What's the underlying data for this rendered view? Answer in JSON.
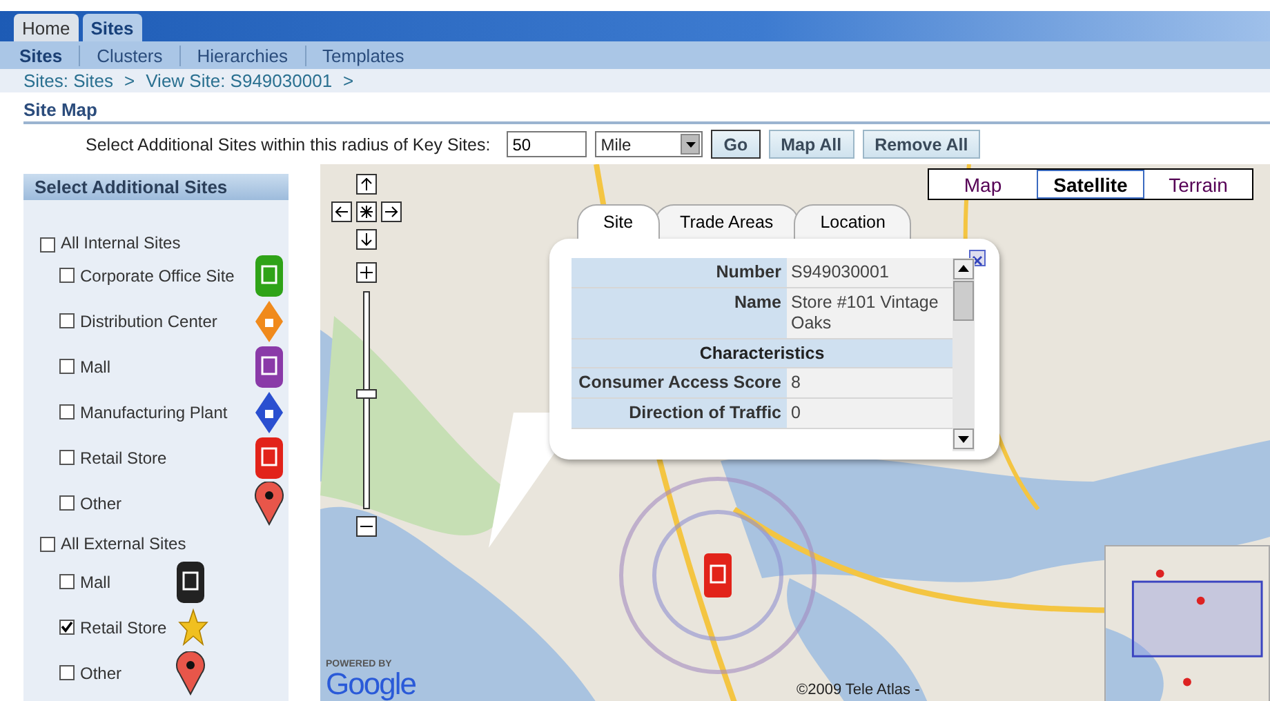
{
  "top_tabs": [
    {
      "label": "Home",
      "selected": false
    },
    {
      "label": "Sites",
      "selected": true
    }
  ],
  "sub_nav": [
    {
      "label": "Sites",
      "selected": true
    },
    {
      "label": "Clusters",
      "selected": false
    },
    {
      "label": "Hierarchies",
      "selected": false
    },
    {
      "label": "Templates",
      "selected": false
    }
  ],
  "breadcrumbs": {
    "separator": ">",
    "items": [
      "Sites: Sites",
      "View Site: S949030001"
    ]
  },
  "section_title": "Site Map",
  "radius": {
    "label": "Select Additional Sites within this radius of Key Sites:",
    "value": "50",
    "unit": "Mile",
    "buttons": [
      "Go",
      "Map All",
      "Remove All"
    ]
  },
  "filter_panel": {
    "title": "Select Additional Sites",
    "groups": [
      {
        "label": "All Internal Sites",
        "checked": false,
        "children": [
          {
            "label": "Corporate Office Site",
            "checked": false,
            "kind": "badge",
            "color": "#2fa318"
          },
          {
            "label": "Distribution Center",
            "checked": false,
            "kind": "diamond",
            "color": "#f08a1c"
          },
          {
            "label": "Mall",
            "checked": false,
            "kind": "badge",
            "color": "#8a3aa8"
          },
          {
            "label": "Manufacturing Plant",
            "checked": false,
            "kind": "diamond",
            "color": "#2a4fd0"
          },
          {
            "label": "Retail Store",
            "checked": false,
            "kind": "badge",
            "color": "#e2231a"
          },
          {
            "label": "Other",
            "checked": false,
            "kind": "pin",
            "color": "#e8564a"
          }
        ]
      },
      {
        "label": "All External Sites",
        "checked": false,
        "children": [
          {
            "label": "Mall",
            "checked": false,
            "kind": "badge",
            "color": "#222222"
          },
          {
            "label": "Retail Store",
            "checked": true,
            "kind": "star",
            "color": "#f0c020"
          },
          {
            "label": "Other",
            "checked": false,
            "kind": "pin",
            "color": "#e8564a"
          }
        ]
      }
    ]
  },
  "map": {
    "map_types": [
      {
        "label": "Map",
        "selected": false
      },
      {
        "label": "Satellite",
        "selected": true
      },
      {
        "label": "Terrain",
        "selected": false
      }
    ],
    "zoom": {
      "level": 0.53
    },
    "popup": {
      "tabs": [
        {
          "label": "Site",
          "selected": true
        },
        {
          "label": "Trade Areas",
          "selected": false
        },
        {
          "label": "Location",
          "selected": false
        }
      ],
      "rows": [
        {
          "kind": "field",
          "label": "Number",
          "value": "S949030001"
        },
        {
          "kind": "field",
          "label": "Name",
          "value": "Store #101 Vintage Oaks"
        },
        {
          "kind": "heading",
          "label": "Characteristics"
        },
        {
          "kind": "field",
          "label": "Consumer Access Score",
          "value": "8"
        },
        {
          "kind": "field",
          "label": "Direction of Traffic",
          "value": "0"
        }
      ]
    },
    "logo": {
      "tagline": "POWERED BY",
      "name": "Google"
    },
    "copyright": "©2009 Tele Atlas -"
  }
}
